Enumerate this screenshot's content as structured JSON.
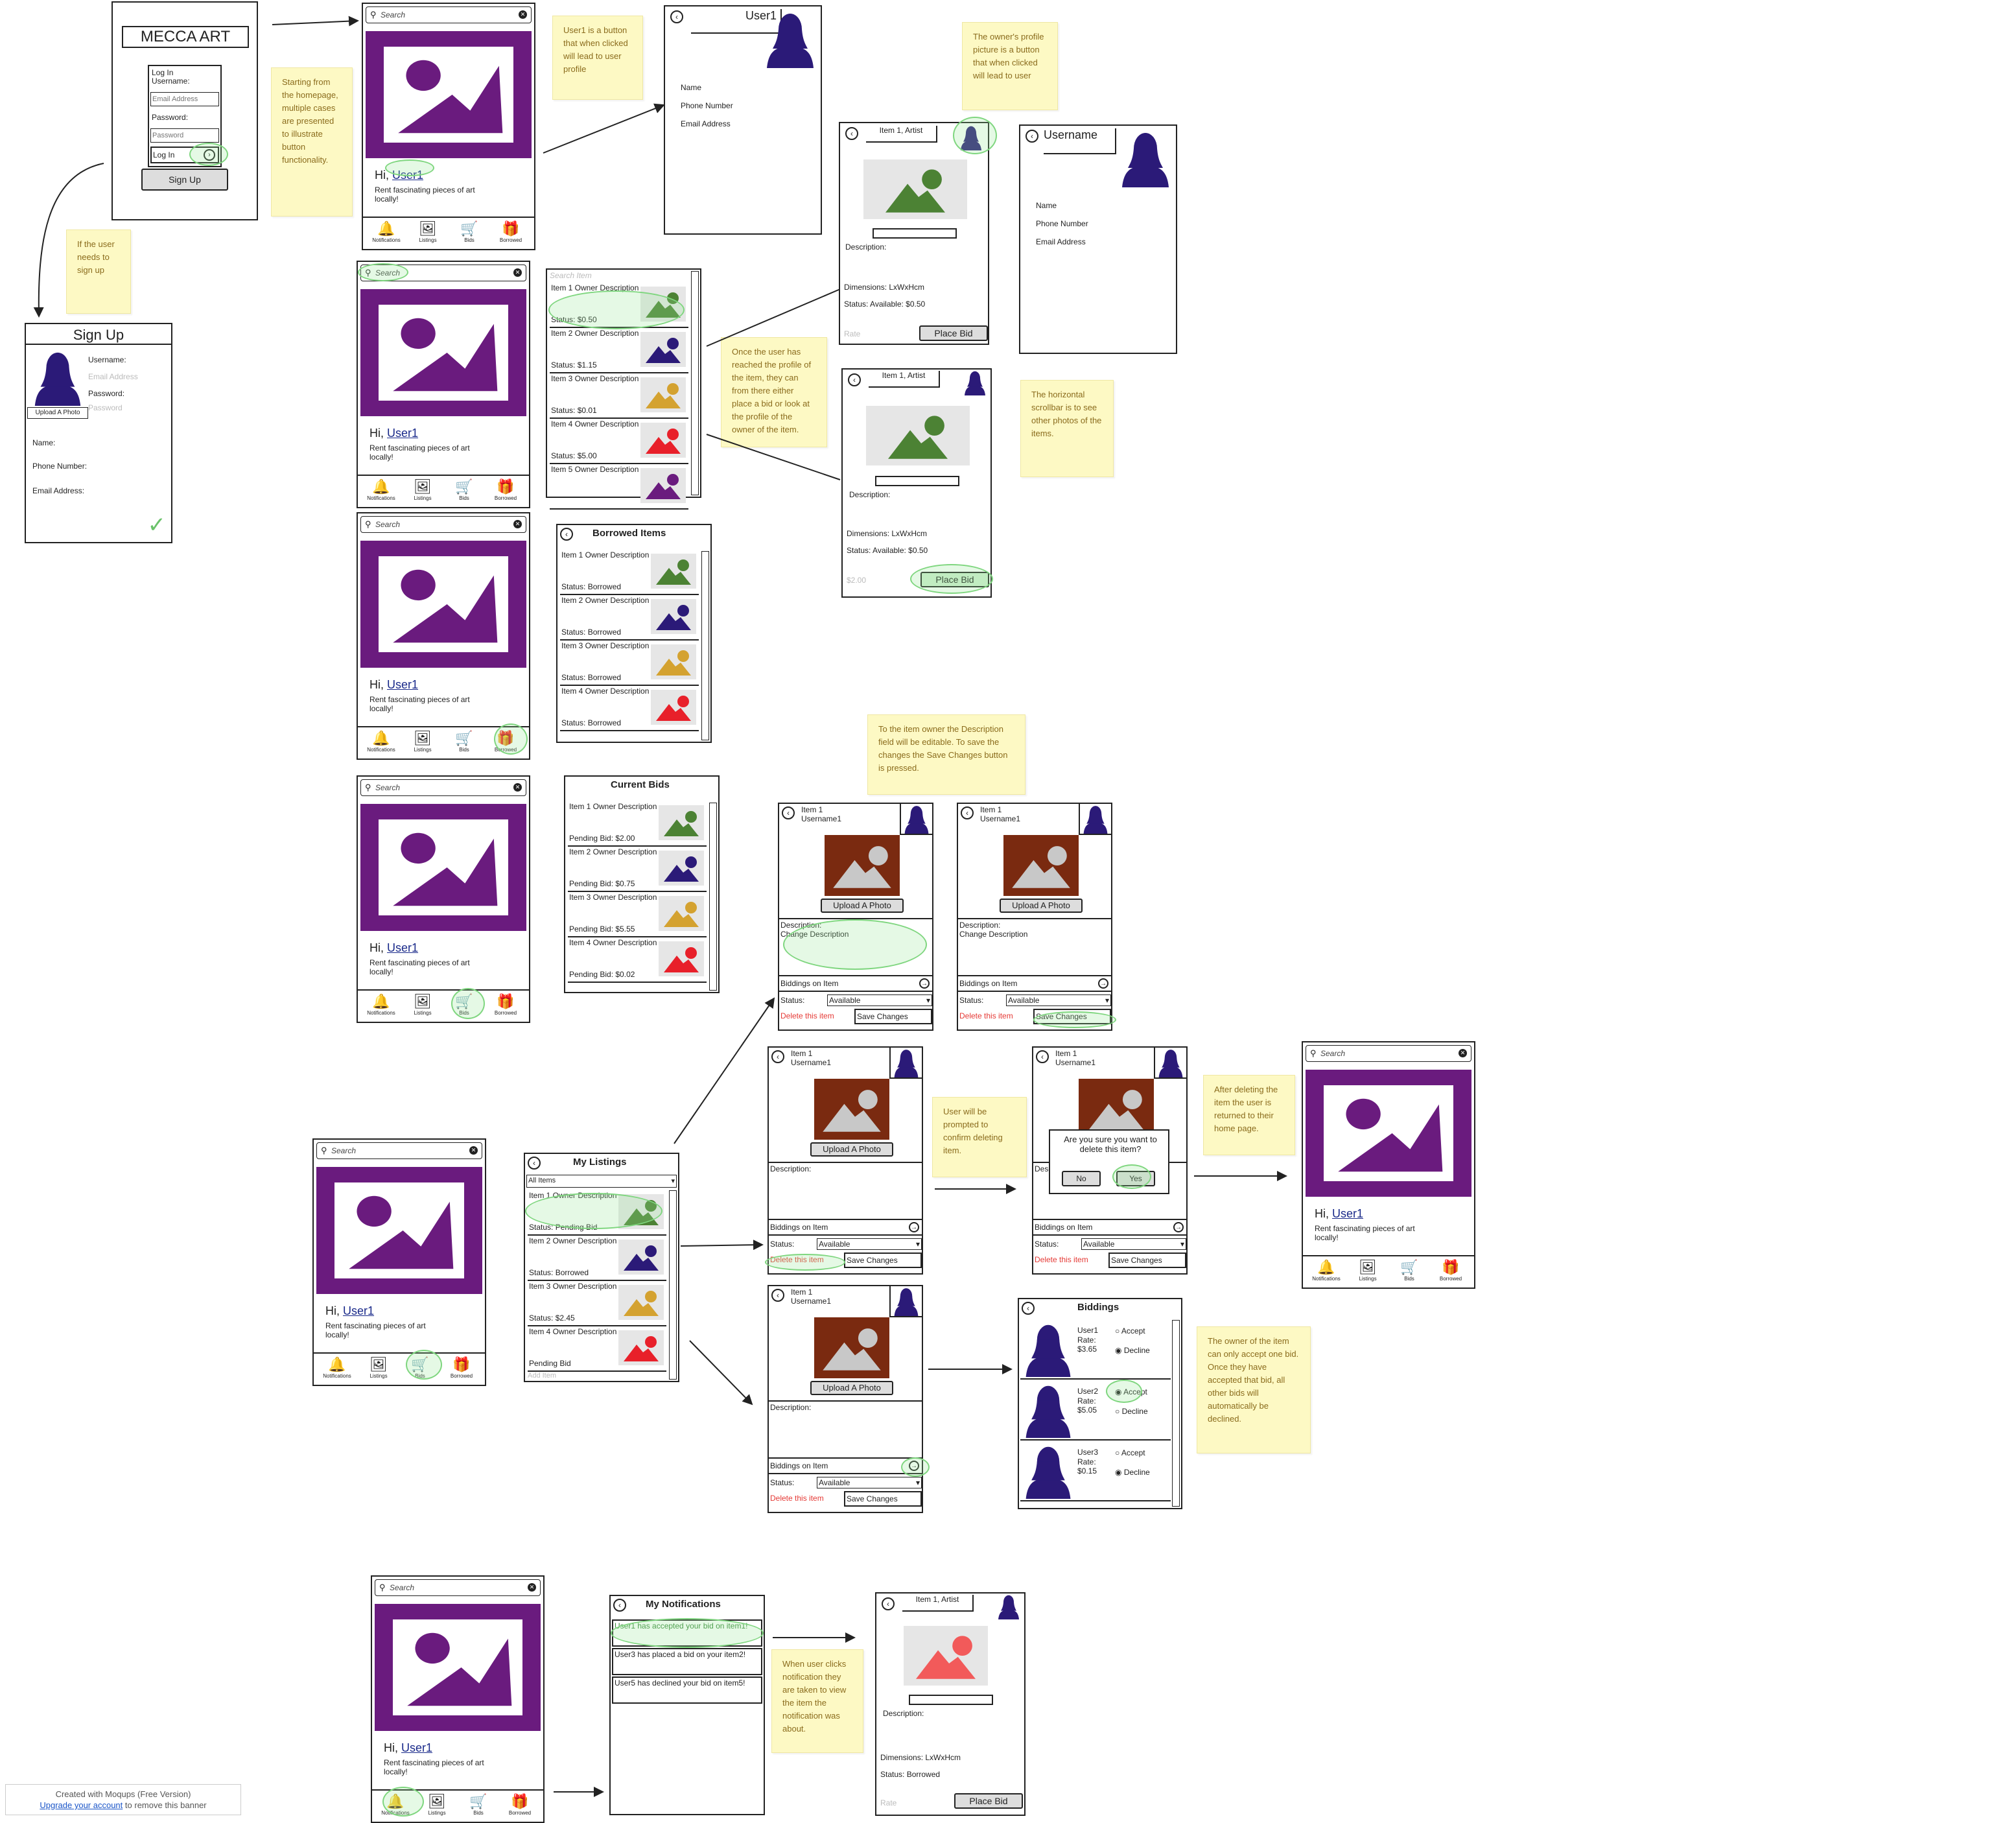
{
  "colors": {
    "brand_purple": "#6a1b7e",
    "avatar_navy": "#2b1a78",
    "sticky_bg": "#fdf9c4",
    "sticky_text": "#8a6b1c",
    "highlight_green": "#7fd67f",
    "delete_red": "#e53935",
    "item_brown": "#7a2a10"
  },
  "login": {
    "title": "MECCA ART",
    "username_label": "Log In Username:",
    "email_placeholder": "Email Address",
    "password_label": "Password:",
    "password_placeholder": "Password",
    "login_label": "Log In",
    "signup_button": "Sign Up"
  },
  "signup": {
    "title": "Sign Up",
    "upload": "Upload A Photo",
    "username_label": "Username:",
    "email_placeholder": "Email Address",
    "password_label": "Password:",
    "password_placeholder": "Password",
    "name_label": "Name:",
    "phone_label": "Phone Number:",
    "email_label": "Email Address:",
    "check": "✓"
  },
  "home": {
    "search": "Search",
    "greeting": "Hi,",
    "user": "User1",
    "tagline": "Rent fascinating pieces of art locally!",
    "nav": [
      "Notifications",
      "Listings",
      "Bids",
      "Borrowed"
    ]
  },
  "profile": {
    "user_title": "User1",
    "username_title": "Username",
    "fields": [
      "Name",
      "Phone Number",
      "Email Address"
    ]
  },
  "notes": {
    "n1": "Starting from the homepage, multiple cases are presented to illustrate button functionality.",
    "n2": "If the user needs to sign up",
    "n3": "User1 is a button that when clicked will lead to user profile",
    "n4": "The owner's profile picture is a button that when clicked will lead to user",
    "n5": "Once the user has reached the profile of the item, they can from there either place a bid or look at the profile of the owner of the item.",
    "n6": "The horizontal scrollbar is to see other photos of the items.",
    "n7": "To the item owner the Description field will be editable. To save the changes the Save Changes button is pressed.",
    "n8": "User will be prompted to confirm deleting item.",
    "n9": "After deleting the item the user is returned to their home page.",
    "n10": "The owner of the item can only accept one bid. Once they have accepted that bid, all other bids will automatically be declined.",
    "n11": "When user clicks notification they are taken to view the item the notification was about."
  },
  "search_list": {
    "search": "Search Item",
    "items": [
      {
        "desc": "Item 1 Owner Description",
        "status": "Status: $0.50"
      },
      {
        "desc": "Item 2 Owner Description",
        "status": "Status: $1.15"
      },
      {
        "desc": "Item 3 Owner Description",
        "status": "Status: $0.01"
      },
      {
        "desc": "Item 4 Owner Description",
        "status": "Status: $5.00"
      },
      {
        "desc": "Item 5 Owner Description",
        "status": ""
      }
    ]
  },
  "item_detail": {
    "title": "Item 1, Artist",
    "description": "Description:",
    "dimensions": "Dimensions: LxWxHcm",
    "status": "Status: Available: $0.50",
    "status_borrowed": "Status: Borrowed",
    "rate_placeholder": "Rate",
    "rate_value": "$2.00",
    "place_bid": "Place Bid"
  },
  "borrowed": {
    "title": "Borrowed Items",
    "items": [
      {
        "desc": "Item 1 Owner Description",
        "status": "Status: Borrowed"
      },
      {
        "desc": "Item 2 Owner Description",
        "status": "Status: Borrowed"
      },
      {
        "desc": "Item 3 Owner Description",
        "status": "Status: Borrowed"
      },
      {
        "desc": "Item 4 Owner Description",
        "status": "Status: Borrowed"
      }
    ]
  },
  "bids": {
    "title": "Current Bids",
    "items": [
      {
        "desc": "Item 1 Owner Description",
        "status": "Pending Bid: $2.00"
      },
      {
        "desc": "Item 2 Owner Description",
        "status": "Pending Bid: $0.75"
      },
      {
        "desc": "Item 3 Owner Description",
        "status": "Pending Bid: $5.55"
      },
      {
        "desc": "Item 4 Owner Description",
        "status": "Pending Bid: $0.02"
      }
    ]
  },
  "listings": {
    "title": "My Listings",
    "filter": "All Items",
    "items": [
      {
        "desc": "Item 1 Owner Description",
        "status": "Status: Pending Bid"
      },
      {
        "desc": "Item 2 Owner Description",
        "status": "Status: Borrowed"
      },
      {
        "desc": "Item 3 Owner Description",
        "status": "Status: $2.45"
      },
      {
        "desc": "Item 4 Owner Description",
        "status": "Pending Bid"
      }
    ],
    "add_placeholder": "Add Item"
  },
  "edit_item": {
    "title": "Item 1 Username1",
    "upload": "Upload A Photo",
    "description": "Description:",
    "change_description": "Change Description",
    "biddings": "Biddings on Item",
    "status_label": "Status:",
    "status_value": "Available",
    "delete": "Delete this item",
    "save": "Save Changes"
  },
  "confirm": {
    "question": "Are you sure you want to delete this item?",
    "no": "No",
    "yes": "Yes"
  },
  "biddings": {
    "title": "Biddings",
    "rows": [
      {
        "user": "User1",
        "rate_label": "Rate:",
        "rate": "$3.65"
      },
      {
        "user": "User2",
        "rate_label": "Rate:",
        "rate": "$5.05"
      },
      {
        "user": "User3",
        "rate_label": "Rate:",
        "rate": "$0.15"
      }
    ],
    "accept": "Accept",
    "decline": "Decline"
  },
  "notifications": {
    "title": "My Notifications",
    "items": [
      "User1 has accepted your bid on item1!",
      "User3 has placed a bid on your item2!",
      "User5 has declined your bid on item5!"
    ]
  },
  "banner": {
    "line1": "Created with Moqups (Free Version)",
    "link": "Upgrade your account",
    "line2": "to remove this banner"
  }
}
